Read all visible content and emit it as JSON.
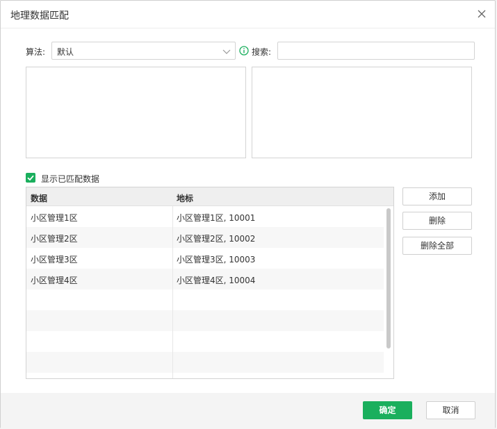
{
  "dialog": {
    "title": "地理数据匹配",
    "close_icon": "close-icon"
  },
  "algorithm": {
    "label": "算法:",
    "value": "默认",
    "chevron_icon": "chevron-down-icon"
  },
  "search": {
    "info_icon": "info-icon",
    "label": "搜索:",
    "value": "",
    "placeholder": ""
  },
  "show_matched": {
    "label": "显示已匹配数据",
    "checked": true
  },
  "table": {
    "columns": [
      "数据",
      "地标"
    ],
    "rows": [
      [
        "小区管理1区",
        "小区管理1区, 10001"
      ],
      [
        "小区管理2区",
        "小区管理2区, 10002"
      ],
      [
        "小区管理3区",
        "小区管理3区, 10003"
      ],
      [
        "小区管理4区",
        "小区管理4区, 10004"
      ]
    ]
  },
  "actions": {
    "add": "添加",
    "delete": "删除",
    "delete_all": "删除全部"
  },
  "footer": {
    "ok": "确定",
    "cancel": "取消"
  },
  "colors": {
    "accent": "#1aaf5d",
    "info": "#1aaf5d"
  }
}
